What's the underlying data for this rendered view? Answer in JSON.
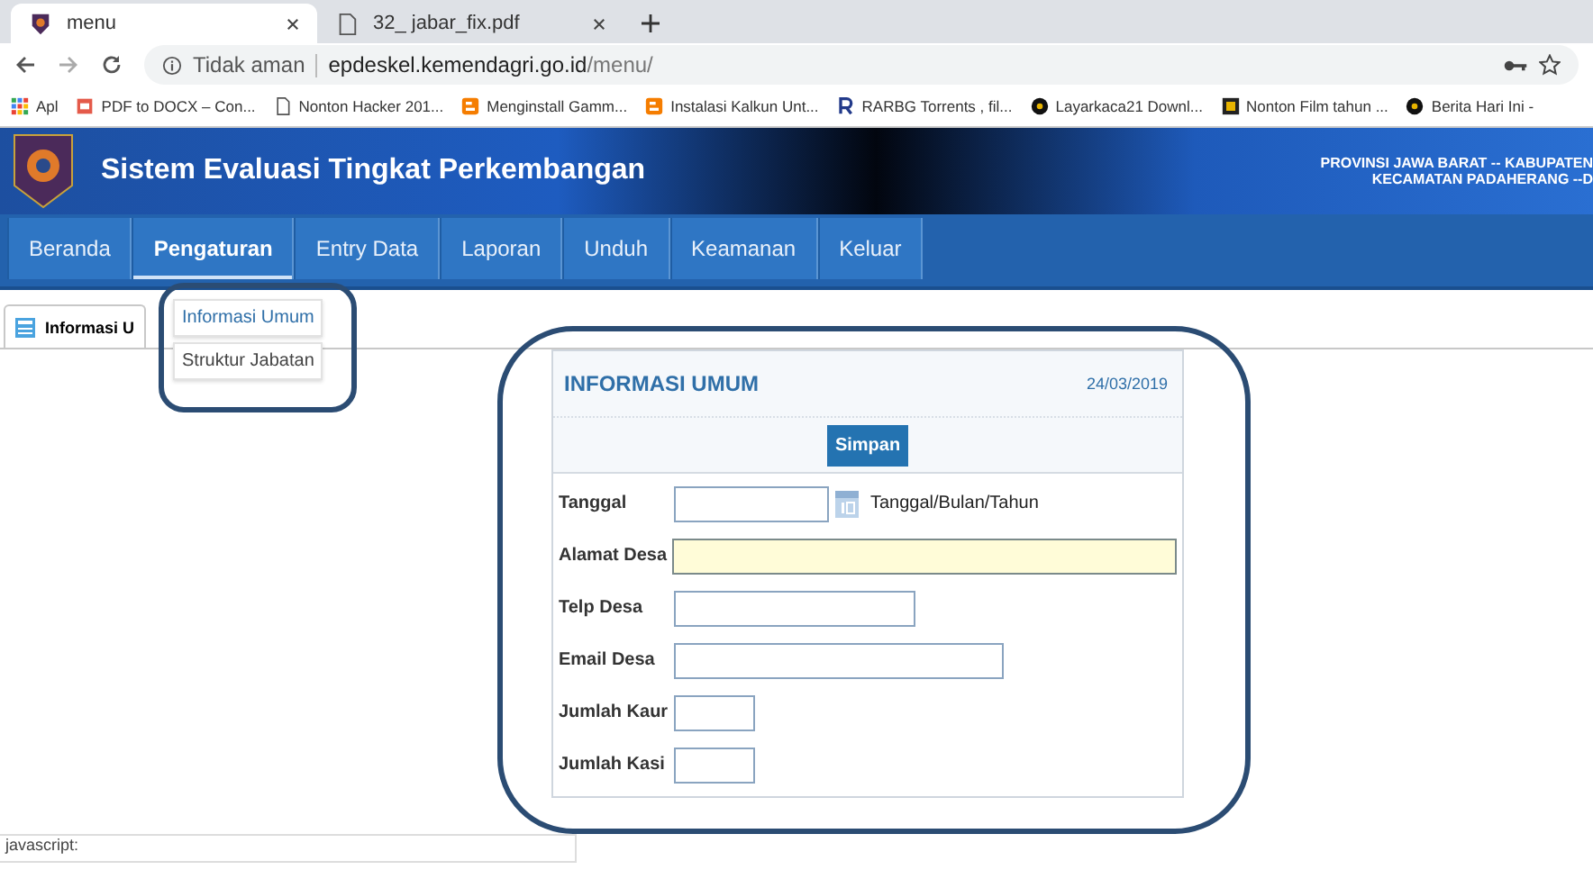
{
  "browser": {
    "tabs": [
      {
        "title": "menu",
        "selected": true
      },
      {
        "title": "32_ jabar_fix.pdf",
        "selected": false
      }
    ],
    "security": "Tidak aman",
    "url_host": "epdeskel.kemendagri.go.id",
    "url_path": "/menu/",
    "bookmarks": [
      {
        "kind": "apps",
        "label": "Apl"
      },
      {
        "kind": "pdf",
        "label": "PDF to DOCX – Con..."
      },
      {
        "kind": "page",
        "label": "Nonton Hacker 201..."
      },
      {
        "kind": "blogger",
        "label": "Menginstall Gamm..."
      },
      {
        "kind": "blogger",
        "label": "Instalasi Kalkun Unt..."
      },
      {
        "kind": "letter",
        "label": "RARBG Torrents , fil..."
      },
      {
        "kind": "disc",
        "label": "Layarkaca21 Downl..."
      },
      {
        "kind": "film",
        "label": "Nonton Film tahun ..."
      },
      {
        "kind": "disc",
        "label": "Berita Hari Ini -"
      }
    ]
  },
  "header": {
    "title": "Sistem Evaluasi Tingkat Perkembangan",
    "region_lines": [
      "PROVINSI JAWA BARAT -- KABUPATEN",
      "KECAMATAN PADAHERANG --D"
    ]
  },
  "nav": [
    {
      "label": "Beranda",
      "selected": false
    },
    {
      "label": "Pengaturan",
      "selected": true
    },
    {
      "label": "Entry Data",
      "selected": false
    },
    {
      "label": "Laporan",
      "selected": false
    },
    {
      "label": "Unduh",
      "selected": false
    },
    {
      "label": "Keamanan",
      "selected": false
    },
    {
      "label": "Keluar",
      "selected": false
    }
  ],
  "dropdown": [
    {
      "label": "Informasi Umum",
      "selected": true
    },
    {
      "label": "Struktur Jabatan",
      "selected": false
    }
  ],
  "page_tab": {
    "label": "Informasi U"
  },
  "form": {
    "title": "INFORMASI UMUM",
    "date": "24/03/2019",
    "button": "Simpan",
    "fields": [
      {
        "label": "Tanggal",
        "kind": "date",
        "hint": "Tanggal/Bulan/Tahun",
        "focused": false
      },
      {
        "label": "Alamat Desa",
        "kind": "full",
        "focused": true
      },
      {
        "label": "Telp Desa",
        "kind": "medium",
        "focused": false
      },
      {
        "label": "Email Desa",
        "kind": "long",
        "focused": false
      },
      {
        "label": "Jumlah Kaur",
        "kind": "short",
        "focused": false
      },
      {
        "label": "Jumlah Kasi",
        "kind": "short",
        "focused": false
      }
    ]
  },
  "status_bar": "javascript:"
}
